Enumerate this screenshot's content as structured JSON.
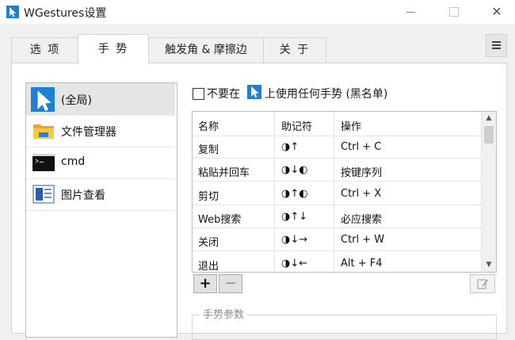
{
  "window": {
    "title": "WGestures设置",
    "controls": {
      "minimize": "—",
      "maximize": "☐",
      "close": "✕"
    }
  },
  "tabs": [
    {
      "label": "选 项",
      "active": false
    },
    {
      "label": "手 势",
      "active": true
    },
    {
      "label": "触发角 & 摩擦边",
      "active": false
    },
    {
      "label": "关 于",
      "active": false
    }
  ],
  "menu_button": {
    "icon": "hamburger-menu-icon"
  },
  "apps": [
    {
      "label": "(全局)",
      "icon": "global-cursor-icon",
      "selected": true
    },
    {
      "label": "文件管理器",
      "icon": "folder-icon",
      "selected": false
    },
    {
      "label": "cmd",
      "icon": "console-icon",
      "selected": false
    },
    {
      "label": "图片查看",
      "icon": "image-viewer-icon",
      "selected": false
    }
  ],
  "blacklist": {
    "text_before": "不要在",
    "icon": "global-cursor-icon",
    "text_after": "上使用任何手势 (黑名单)",
    "checked": false
  },
  "gesture_table": {
    "headers": [
      "名称",
      "助记符",
      "操作"
    ],
    "rows": [
      {
        "name": "复制",
        "mnemonic": "◑↑",
        "action": "Ctrl + C"
      },
      {
        "name": "粘贴并回车",
        "mnemonic": "◑↓◐",
        "action": "按键序列"
      },
      {
        "name": "剪切",
        "mnemonic": "◑↑◐",
        "action": "Ctrl + X"
      },
      {
        "name": "Web搜索",
        "mnemonic": "◑↑↓",
        "action": "必应搜索"
      },
      {
        "name": "关闭",
        "mnemonic": "◑↓→",
        "action": "Ctrl + W"
      },
      {
        "name": "退出",
        "mnemonic": "◑↓←",
        "action": "Alt + F4"
      }
    ]
  },
  "buttons": {
    "add": "+",
    "remove": "−",
    "edit_icon": "edit-icon"
  },
  "gesture_params": {
    "legend": "手势参数"
  },
  "colors": {
    "accent": "#1e7fd6",
    "selected_bg": "#e5e5e5",
    "tab_active_bg": "#ffffff"
  }
}
